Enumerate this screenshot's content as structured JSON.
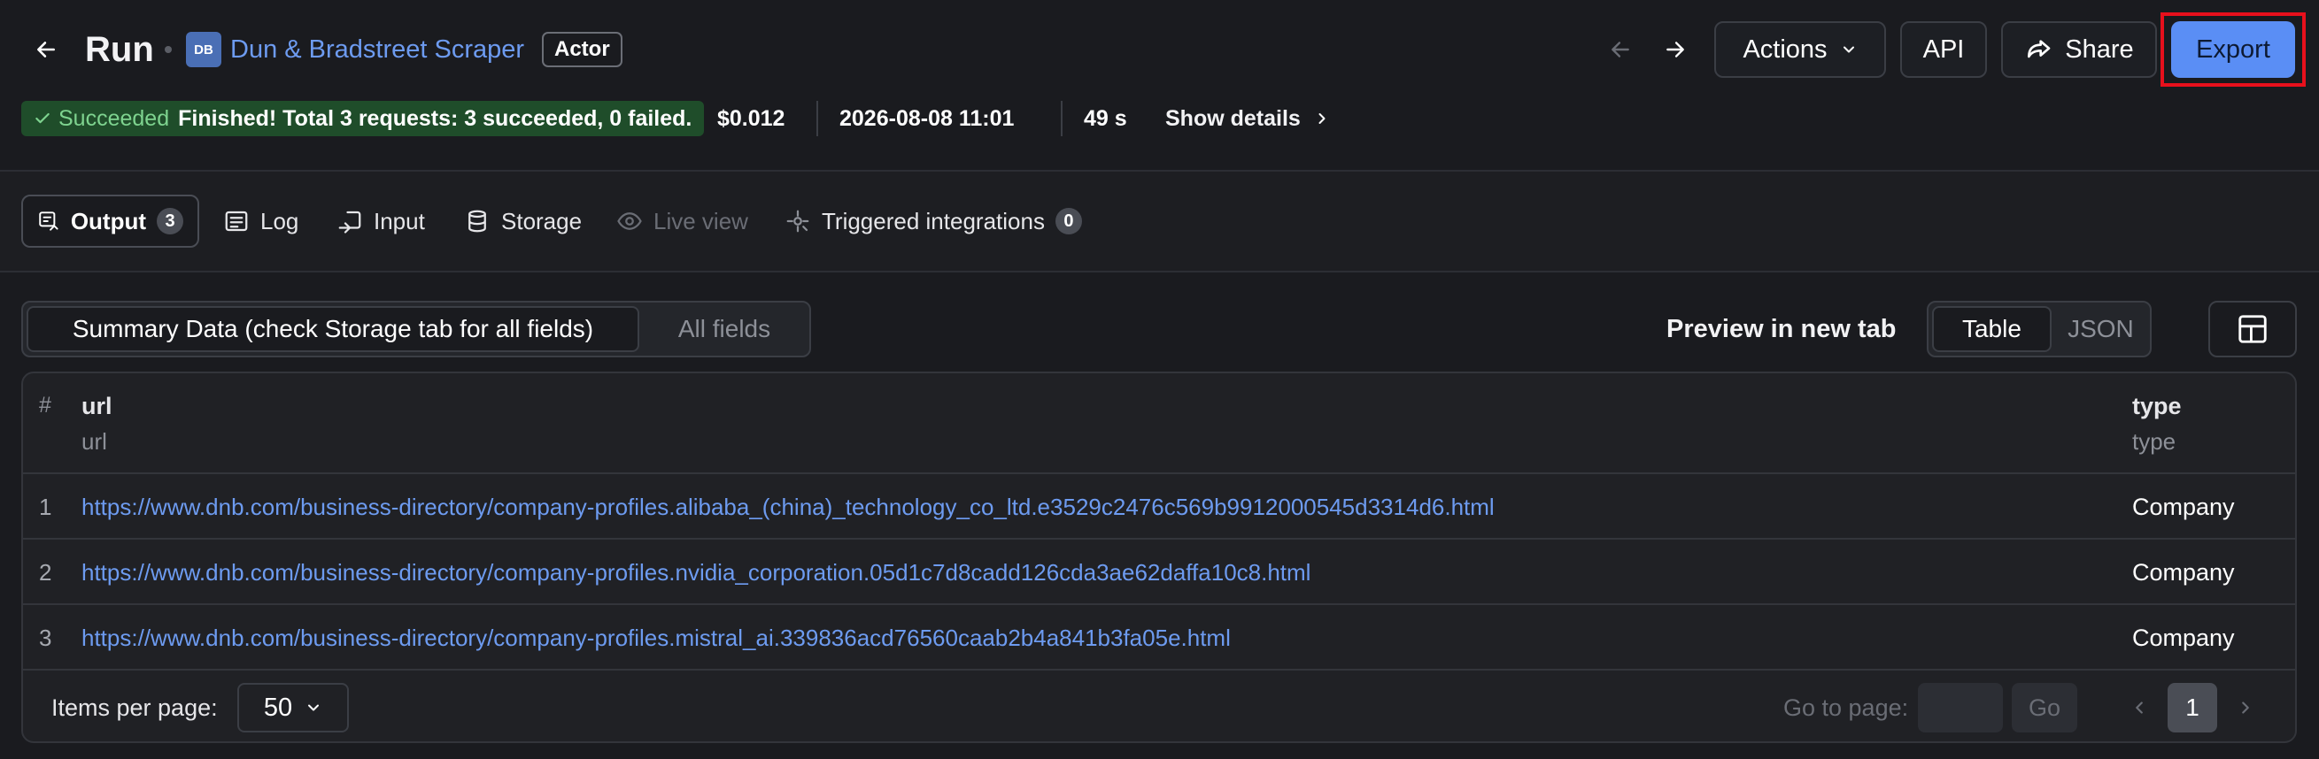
{
  "header": {
    "title": "Run",
    "actor_initials": "DB",
    "actor_name": "Dun & Bradstreet Scraper",
    "actor_badge": "Actor",
    "buttons": {
      "actions": "Actions",
      "api": "API",
      "share": "Share",
      "export": "Export"
    }
  },
  "status": {
    "state": "Succeeded",
    "message": "Finished! Total 3 requests: 3 succeeded, 0 failed.",
    "cost": "$0.012",
    "started": "2026-08-08 11:01",
    "duration": "49 s",
    "show_details": "Show details"
  },
  "tabs": [
    {
      "label": "Output",
      "count": "3",
      "active": true
    },
    {
      "label": "Log"
    },
    {
      "label": "Input"
    },
    {
      "label": "Storage"
    },
    {
      "label": "Live view",
      "disabled": true
    },
    {
      "label": "Triggered integrations",
      "count": "0"
    }
  ],
  "views": {
    "summary": "Summary Data (check Storage tab for all fields)",
    "all_fields": "All fields",
    "preview": "Preview in new tab",
    "table": "Table",
    "json": "JSON"
  },
  "table": {
    "columns": [
      {
        "header": "#"
      },
      {
        "header": "url",
        "sub": "url"
      },
      {
        "header": "type",
        "sub": "type"
      }
    ],
    "rows": [
      {
        "num": "1",
        "url": "https://www.dnb.com/business-directory/company-profiles.alibaba_(china)_technology_co_ltd.e3529c2476c569b9912000545d3314d6.html",
        "type": "Company"
      },
      {
        "num": "2",
        "url": "https://www.dnb.com/business-directory/company-profiles.nvidia_corporation.05d1c7d8cadd126cda3ae62daffa10c8.html",
        "type": "Company"
      },
      {
        "num": "3",
        "url": "https://www.dnb.com/business-directory/company-profiles.mistral_ai.339836acd76560caab2b4a841b3fa05e.html",
        "type": "Company"
      }
    ]
  },
  "pagination": {
    "items_per_page_label": "Items per page:",
    "items_per_page": "50",
    "go_to_page_label": "Go to page:",
    "go_label": "Go",
    "current_page": "1"
  },
  "colors": {
    "accent": "#5a8ef5",
    "link": "#6d9bf0",
    "success_bg": "#1f4d2a",
    "success_text": "#7ed38f",
    "highlight_outline": "#e8101c"
  }
}
